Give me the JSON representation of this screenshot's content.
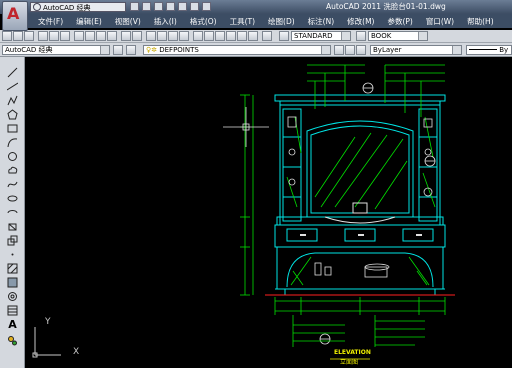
{
  "app": {
    "title": "AutoCAD 2011  洗脸台01-01.dwg",
    "logo": "A",
    "workspace": "AutoCAD 经典"
  },
  "menu": [
    "文件(F)",
    "编辑(E)",
    "视图(V)",
    "插入(I)",
    "格式(O)",
    "工具(T)",
    "绘图(D)",
    "标注(N)",
    "修改(M)",
    "参数(P)",
    "窗口(W)",
    "帮助(H)"
  ],
  "toolbar": {
    "text_style": "STANDARD",
    "dim_style": "BOOK",
    "workspace_combo": "AutoCAD 经典",
    "layer": "DEFPOINTS",
    "color": "ByLayer",
    "linetype": "By"
  },
  "drawing": {
    "title": "ELEVATION",
    "subtitle": "立面图",
    "ucs_x": "X",
    "ucs_y": "Y"
  },
  "colors": {
    "canvas_bg": "#000000",
    "cyan": "#00e5e5",
    "green": "#00e000",
    "yellow": "#f0f000",
    "white": "#e0e0e0",
    "red": "#ff2020",
    "titlebar": "#3c4c63"
  }
}
